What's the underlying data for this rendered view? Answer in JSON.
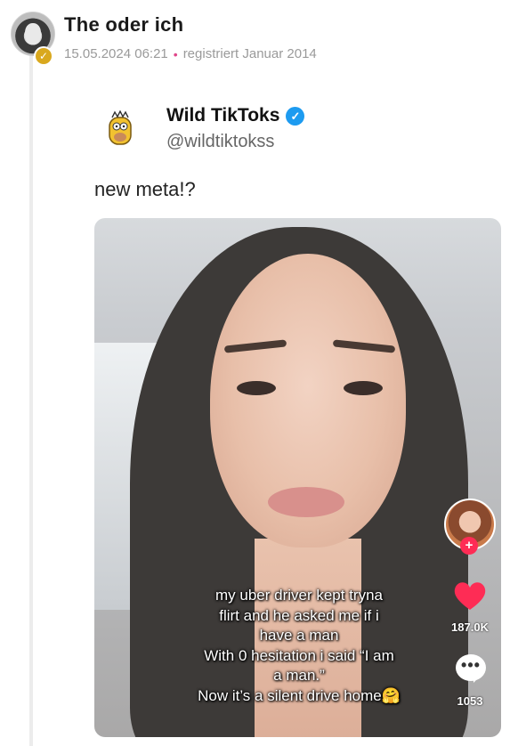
{
  "post": {
    "author": "The oder ich",
    "date": "15.05.2024 06:21",
    "separator": "•",
    "registered": "registriert Januar 2014"
  },
  "tweet": {
    "name": "Wild TikToks",
    "handle": "@wildtiktokss",
    "text": "new meta!?"
  },
  "video": {
    "caption_lines": [
      "my uber driver kept tryna",
      "flirt and he asked me if i",
      "have a man",
      "With 0 hesitation i said “I am",
      "a man.”",
      "Now it’s a silent drive home🤗"
    ],
    "likes": "187.0K",
    "comments": "1053",
    "follow_symbol": "+"
  },
  "colors": {
    "badge": "#d9a81e",
    "separator_dot": "#e0478a",
    "twitter_verified": "#1d9bf0",
    "tiktok_red": "#fe2c55"
  },
  "icons": {
    "avatar_badge": "check-icon",
    "tweet_verified": "verified-check-icon",
    "like": "heart-icon",
    "comment": "comment-bubble-icon"
  }
}
